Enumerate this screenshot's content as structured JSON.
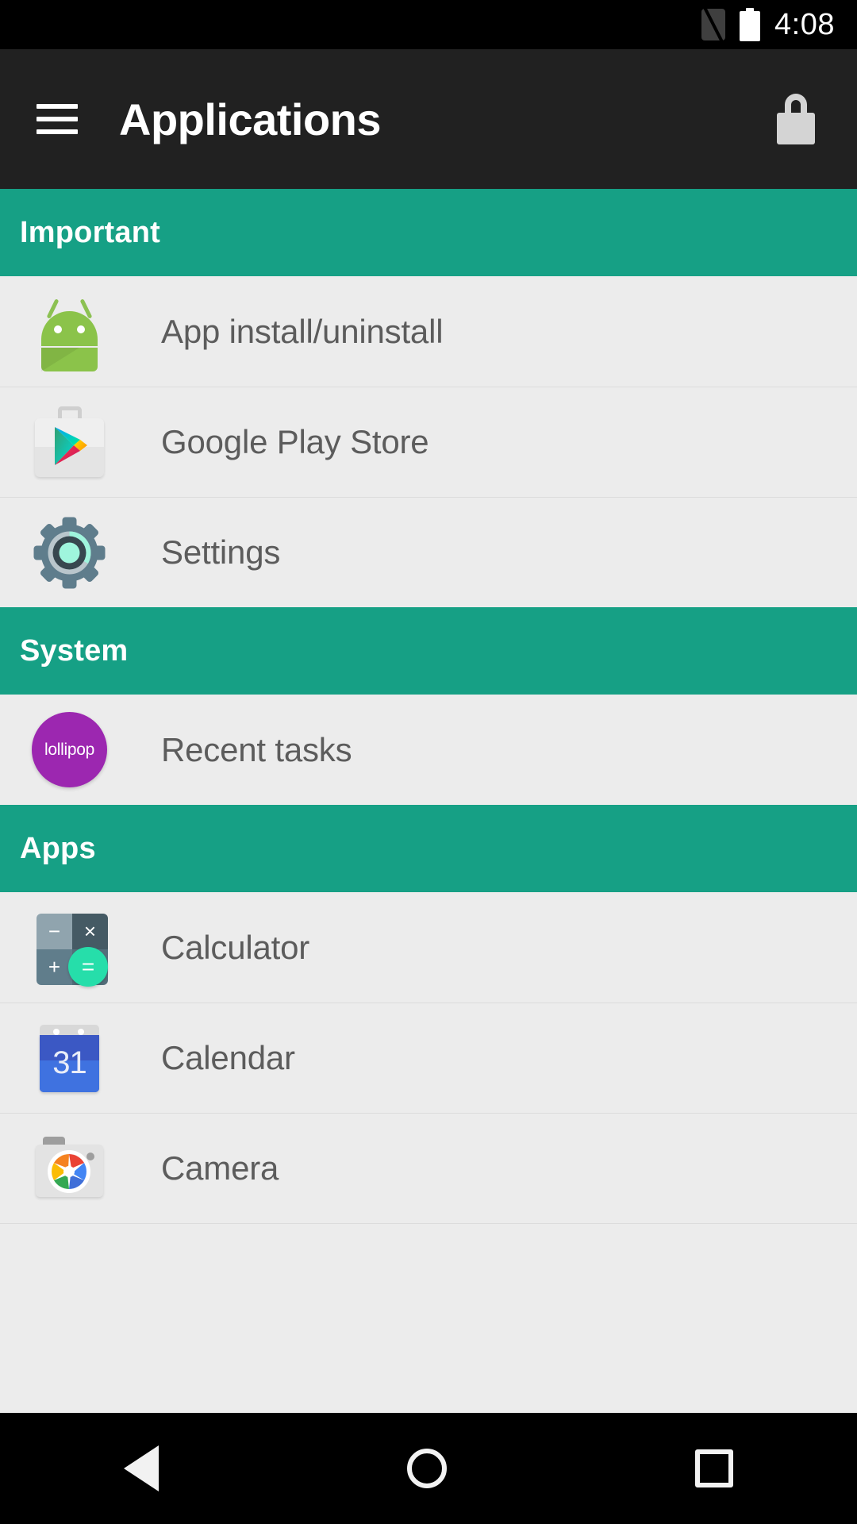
{
  "status_bar": {
    "time": "4:08",
    "icons": [
      {
        "name": "no-sim-icon",
        "color": "#3f3f3f"
      },
      {
        "name": "battery-full-icon",
        "color": "#ffffff"
      }
    ],
    "background": "#000000"
  },
  "action_bar": {
    "menu_icon": "hamburger-menu-icon",
    "title": "Applications",
    "lock_icon": "lock-icon",
    "background": "#212121",
    "title_color": "#ffffff"
  },
  "theme": {
    "section_header_bg": "#16a085",
    "list_bg": "#ececec",
    "divider": "#dcdcdc",
    "label_color": "#5c5c5c"
  },
  "sections": [
    {
      "header": "Important",
      "items": [
        {
          "label": "App install/uninstall",
          "icon": "android-robot-icon"
        },
        {
          "label": "Google Play Store",
          "icon": "google-play-store-icon"
        },
        {
          "label": "Settings",
          "icon": "settings-gear-icon"
        }
      ]
    },
    {
      "header": "System",
      "items": [
        {
          "label": "Recent tasks",
          "icon": "lollipop-circle-icon",
          "icon_text": "lollipop"
        }
      ]
    },
    {
      "header": "Apps",
      "items": [
        {
          "label": "Calculator",
          "icon": "calculator-icon"
        },
        {
          "label": "Calendar",
          "icon": "calendar-icon",
          "icon_text": "31"
        },
        {
          "label": "Camera",
          "icon": "camera-icon"
        }
      ]
    }
  ],
  "nav_bar": {
    "back": "back-nav-button",
    "home": "home-nav-button",
    "recents": "recents-nav-button",
    "background": "#000000"
  },
  "calculator_icon_symbols": {
    "minus": "−",
    "times": "×",
    "plus": "+",
    "equals": "="
  }
}
